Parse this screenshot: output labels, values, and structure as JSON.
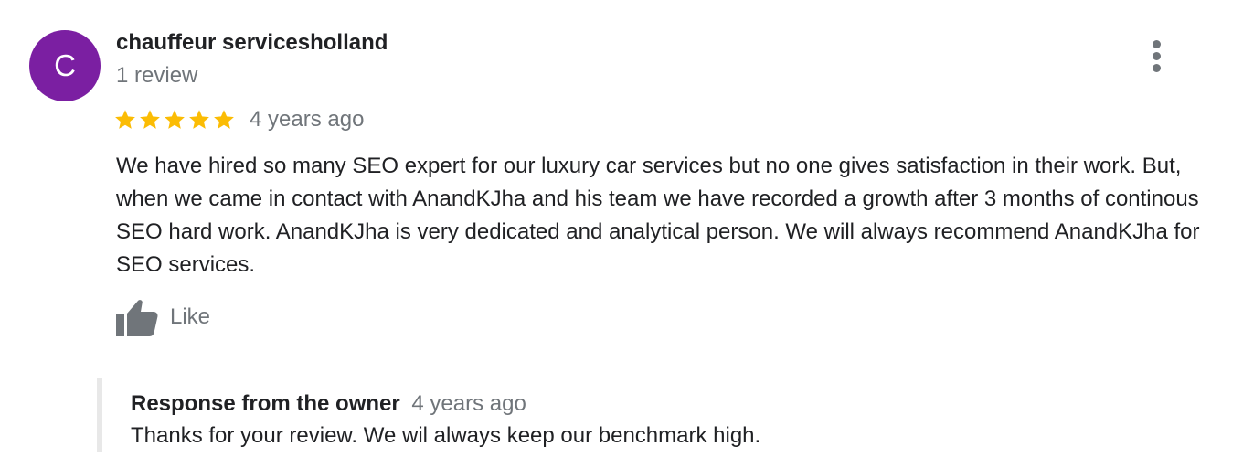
{
  "review": {
    "avatar_letter": "C",
    "avatar_color": "#7b1fa2",
    "author_name": "chauffeur servicesholland",
    "review_count": "1 review",
    "menu_icon": "more-vert-icon",
    "rating": 5,
    "rating_max": 5,
    "star_color": "#fbbc04",
    "time": "4 years ago",
    "text": "We have hired so many SEO expert for our luxury car services but no one gives satisfaction in their work. But, when we came in contact with AnandKJha and his team we have recorded a growth after 3 months of continous SEO hard work. AnandKJha is very dedicated and analytical person. We will always recommend AnandKJha for SEO services.",
    "like_label": "Like",
    "like_icon": "thumbs-up-icon"
  },
  "owner_response": {
    "title": "Response from the owner",
    "time": "4 years ago",
    "text": "Thanks for your review. We wil always keep our benchmark high."
  }
}
